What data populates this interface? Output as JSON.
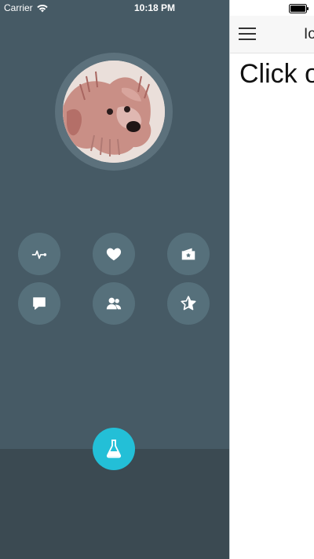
{
  "status_bar": {
    "carrier": "Carrier",
    "time": "10:18 PM"
  },
  "drawer": {
    "avatar_alt": "dog photo",
    "icons": [
      {
        "name": "activity-icon"
      },
      {
        "name": "heart-icon"
      },
      {
        "name": "wallet-star-icon"
      },
      {
        "name": "chat-icon"
      },
      {
        "name": "users-icon"
      },
      {
        "name": "star-icon"
      }
    ],
    "fab": {
      "name": "flask-icon"
    }
  },
  "main": {
    "title": "Io",
    "text": "Click o"
  },
  "colors": {
    "drawer_bg": "#465a65",
    "drawer_footer": "#3b4a52",
    "fab_bg": "#23bfd7",
    "main_bg": "#ffffff"
  }
}
